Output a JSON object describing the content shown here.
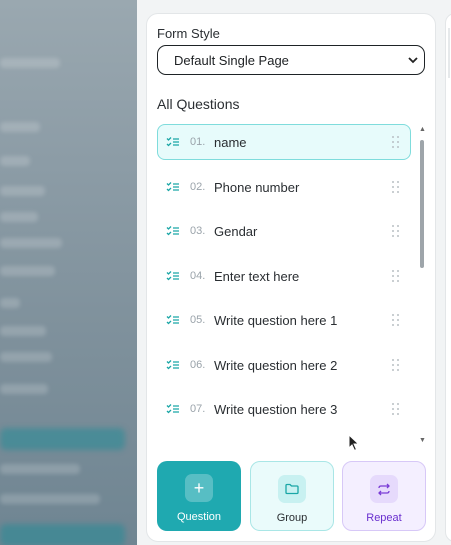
{
  "form_style": {
    "label": "Form Style",
    "selected": "Default Single Page"
  },
  "questions": {
    "heading": "All Questions",
    "items": [
      {
        "num": "01.",
        "text": "name",
        "active": true
      },
      {
        "num": "02.",
        "text": "Phone number",
        "active": false
      },
      {
        "num": "03.",
        "text": "Gendar",
        "active": false
      },
      {
        "num": "04.",
        "text": "Enter text here",
        "active": false
      },
      {
        "num": "05.",
        "text": "Write question here 1",
        "active": false
      },
      {
        "num": "06.",
        "text": "Write question here 2",
        "active": false
      },
      {
        "num": "07.",
        "text": "Write question here 3",
        "active": false
      }
    ]
  },
  "actions": {
    "question_label": "Question",
    "group_label": "Group",
    "repeat_label": "Repeat"
  },
  "colors": {
    "accent": "#1fa9b0",
    "repeat_accent": "#7a3cd6"
  }
}
